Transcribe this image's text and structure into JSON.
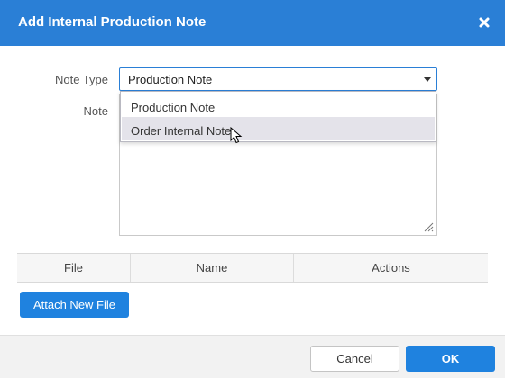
{
  "dialog": {
    "title": "Add Internal Production Note",
    "close_icon": "close-icon",
    "header_color": "#2a7fd6"
  },
  "form": {
    "note_type_label": "Note Type",
    "note_type_value": "Production Note",
    "note_label": "Note",
    "note_value": ""
  },
  "dropdown": {
    "options": [
      "Production Note",
      "Order Internal Note"
    ],
    "hovered_option": "Order Internal Note"
  },
  "files_table": {
    "columns": [
      "File",
      "Name",
      "Actions"
    ],
    "rows": []
  },
  "attach_button_label": "Attach New File",
  "footer": {
    "cancel_label": "Cancel",
    "ok_label": "OK",
    "primary_color": "#1f82df"
  }
}
